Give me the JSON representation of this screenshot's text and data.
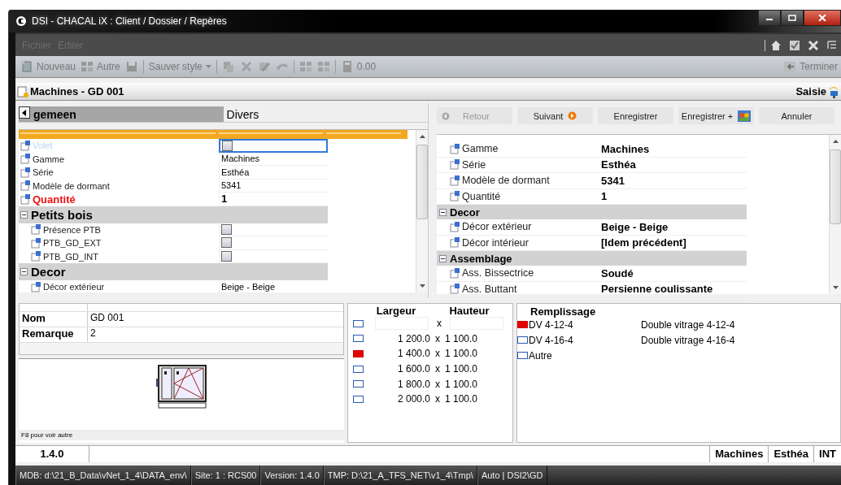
{
  "window": {
    "title": "DSI - CHACAL iX : Client / Dossier / Repères"
  },
  "menu": [
    {
      "label": "Fichier",
      "disabled": true
    },
    {
      "label": "Editer",
      "disabled": true
    }
  ],
  "toolbar": [
    {
      "kind": "button",
      "label": "Nouveau"
    },
    {
      "kind": "button",
      "label": "Autre"
    },
    {
      "kind": "icon"
    },
    {
      "kind": "sep"
    },
    {
      "kind": "dropdown",
      "label": "Sauver style"
    },
    {
      "kind": "sep"
    },
    {
      "kind": "icon"
    },
    {
      "kind": "icon"
    },
    {
      "kind": "icon"
    },
    {
      "kind": "icon"
    },
    {
      "kind": "sep"
    },
    {
      "kind": "icon"
    },
    {
      "kind": "icon"
    },
    {
      "kind": "sep"
    },
    {
      "kind": "button",
      "label": "0.00"
    }
  ],
  "terminer": "Terminer",
  "header": {
    "title": "Machines - GD 001",
    "mode": "Saisie"
  },
  "tabs": [
    {
      "label": "gemeen",
      "selected": true
    },
    {
      "label": "Divers",
      "selected": false
    }
  ],
  "left_grid": [
    {
      "kind": "checkbox",
      "label": "Volet",
      "checked": false,
      "disabled": true,
      "required": false,
      "focused": true
    },
    {
      "kind": "text",
      "label": "Gamme",
      "value": "Machines",
      "disabled": false,
      "required": false,
      "focused": false
    },
    {
      "kind": "text",
      "label": "Série",
      "value": "Esthéa",
      "disabled": false,
      "required": false,
      "focused": false
    },
    {
      "kind": "text",
      "label": "Modèle de dormant",
      "value": "5341",
      "disabled": false,
      "required": false,
      "focused": false
    },
    {
      "kind": "text",
      "label": "Quantité",
      "value": "1",
      "disabled": false,
      "required": true,
      "focused": false
    },
    {
      "kind": "group",
      "label": "Petits bois",
      "expanded": true,
      "children": [
        {
          "kind": "checkbox",
          "label": "Présence PTB",
          "checked": false,
          "disabled": false,
          "required": false,
          "focused": false
        },
        {
          "kind": "checkbox",
          "label": "PTB_GD_EXT",
          "checked": false,
          "disabled": false,
          "required": false,
          "focused": false
        },
        {
          "kind": "checkbox",
          "label": "PTB_GD_INT",
          "checked": false,
          "disabled": false,
          "required": false,
          "focused": false
        }
      ]
    },
    {
      "kind": "group",
      "label": "Decor",
      "expanded": true,
      "children": [
        {
          "kind": "text",
          "label": "Décor extérieur",
          "value": "Beige - Beige",
          "disabled": false,
          "required": false,
          "focused": false
        }
      ]
    }
  ],
  "nav_buttons": [
    {
      "label": "Retour",
      "disabled": true
    },
    {
      "label": "Suivant",
      "disabled": false
    },
    {
      "label": "Enregistrer",
      "disabled": false
    },
    {
      "label": "Enregistrer +",
      "disabled": false
    },
    {
      "label": "Annuler",
      "disabled": false
    }
  ],
  "right_grid": [
    {
      "kind": "property",
      "label": "Gamme",
      "value": "Machines"
    },
    {
      "kind": "property",
      "label": "Série",
      "value": "Esthéa"
    },
    {
      "kind": "property",
      "label": "Modèle de dormant",
      "value": "5341"
    },
    {
      "kind": "property",
      "label": "Quantité",
      "value": "1"
    },
    {
      "kind": "group",
      "label": "Decor",
      "expanded": true,
      "children": [
        {
          "kind": "property",
          "label": "Décor extérieur",
          "value": "Beige - Beige"
        },
        {
          "kind": "property",
          "label": "Décor intérieur",
          "value": "[Idem précédent]"
        }
      ]
    },
    {
      "kind": "group",
      "label": "Assemblage",
      "expanded": true,
      "children": [
        {
          "kind": "property",
          "label": "Ass. Bissectrice",
          "value": "Soudé"
        },
        {
          "kind": "property",
          "label": "Ass. Buttant",
          "value": "Persienne coulissante"
        }
      ]
    }
  ],
  "info": [
    {
      "label": "Nom",
      "value": "GD 001"
    },
    {
      "label": "Remarque",
      "value": "2"
    }
  ],
  "preview_caption": "F8 pour voir autre",
  "sizes": {
    "columns": [
      "Largeur",
      "Hauteur"
    ],
    "rows": [
      {
        "kind": "input",
        "selected": false,
        "separator": "x"
      },
      {
        "kind": "value",
        "width": "1 200.0",
        "separator": "x",
        "height": "1 100.0",
        "selected": false
      },
      {
        "kind": "value",
        "width": "1 400.0",
        "separator": "x",
        "height": "1 100.0",
        "selected": true
      },
      {
        "kind": "value",
        "width": "1 600.0",
        "separator": "x",
        "height": "1 100.0",
        "selected": false
      },
      {
        "kind": "value",
        "width": "1 800.0",
        "separator": "x",
        "height": "1 100.0",
        "selected": false
      },
      {
        "kind": "value",
        "width": "2 000.0",
        "separator": "x",
        "height": "1 100.0",
        "selected": false
      }
    ]
  },
  "filling": {
    "title": "Remplissage",
    "items": [
      {
        "code": "DV 4-12-4",
        "description": "Double vitrage 4-12-4",
        "selected": true
      },
      {
        "code": "DV 4-16-4",
        "description": "Double vitrage 4-16-4",
        "selected": false
      },
      {
        "code": "Autre",
        "selected": false
      }
    ]
  },
  "info_bar": {
    "version": "1.4.0",
    "tags": [
      "Machines",
      "Esthéa",
      "INT"
    ]
  },
  "status_bar": [
    "MDB: d:\\21_B_Data\\vNet_1_4\\DATA_env\\",
    "Site: 1 : RCS00",
    "Version: 1.4.0",
    "TMP: D:\\21_A_TFS_NET\\v1_4\\Tmp\\",
    "Auto | DSI2\\GD"
  ]
}
